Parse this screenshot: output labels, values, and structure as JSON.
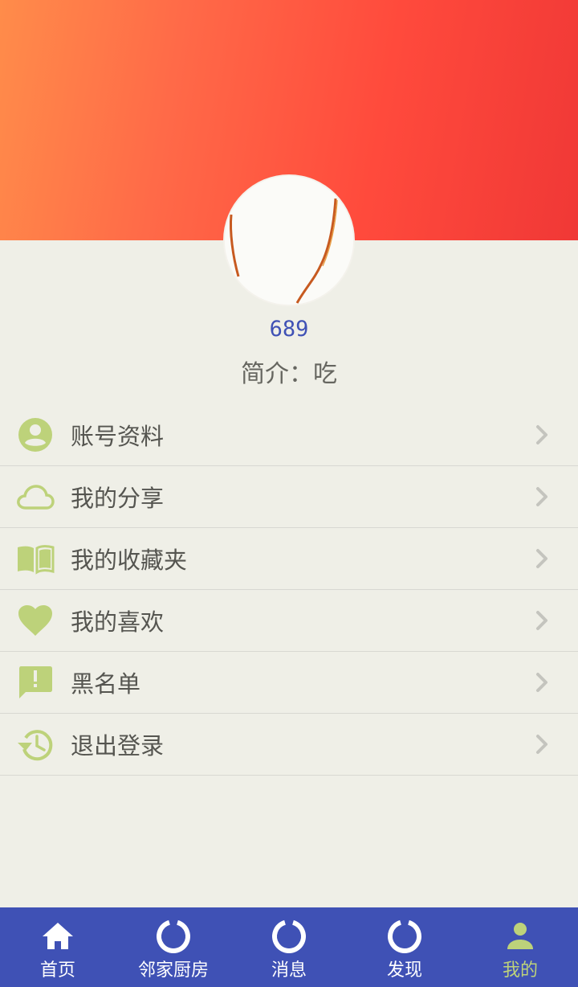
{
  "profile": {
    "username": "689",
    "bio": "简介：吃"
  },
  "menu": {
    "items": [
      {
        "label": "账号资料",
        "icon": "account-circle-icon"
      },
      {
        "label": "我的分享",
        "icon": "cloud-icon"
      },
      {
        "label": "我的收藏夹",
        "icon": "book-icon"
      },
      {
        "label": "我的喜欢",
        "icon": "heart-icon"
      },
      {
        "label": "黑名单",
        "icon": "feedback-icon"
      },
      {
        "label": "退出登录",
        "icon": "history-icon"
      }
    ]
  },
  "bottom_nav": {
    "items": [
      {
        "label": "首页",
        "icon": "home-icon"
      },
      {
        "label": "邻家厨房",
        "icon": "loading-ring-icon"
      },
      {
        "label": "消息",
        "icon": "loading-ring-icon"
      },
      {
        "label": "发现",
        "icon": "loading-ring-icon"
      },
      {
        "label": "我的",
        "icon": "person-icon"
      }
    ],
    "active_index": 4
  },
  "colors": {
    "accent_green": "#bdd27a",
    "nav_blue": "#3f51b5",
    "header_gradient_start": "#ff8c4a",
    "header_gradient_end": "#f03836"
  }
}
